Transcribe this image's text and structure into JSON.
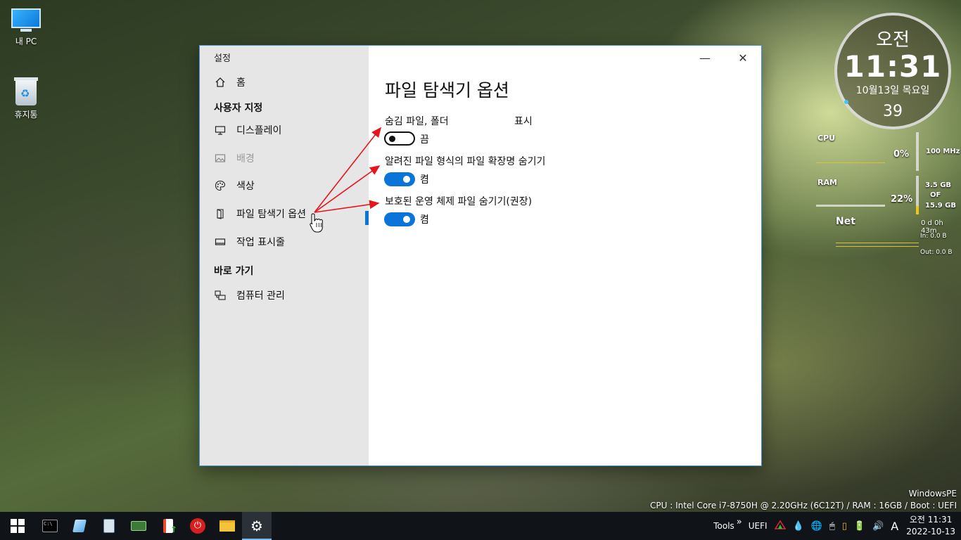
{
  "desktop": {
    "icons": [
      {
        "label": "내 PC"
      },
      {
        "label": "휴지통"
      }
    ]
  },
  "window": {
    "title": "설정",
    "minimize": "—",
    "close": "✕",
    "sidebar": {
      "home": "홈",
      "section_custom": "사용자 지정",
      "items": [
        {
          "label": "디스플레이",
          "icon": "monitor-icon"
        },
        {
          "label": "배경",
          "icon": "picture-icon"
        },
        {
          "label": "색상",
          "icon": "palette-icon"
        },
        {
          "label": "파일 탐색기 옵션",
          "icon": "door-icon"
        },
        {
          "label": "작업 표시줄",
          "icon": "taskbar-icon"
        }
      ],
      "section_shortcut": "바로 가기",
      "shortcut_items": [
        {
          "label": "컴퓨터 관리",
          "icon": "computer-management-icon"
        }
      ]
    },
    "main": {
      "title": "파일 탐색기 옵션",
      "options": [
        {
          "label": "숨김 파일, 폴더",
          "extra": "표시",
          "state": "끔",
          "on": false
        },
        {
          "label": "알려진 파일 형식의 파일 확장명 숨기기",
          "state": "켬",
          "on": true
        },
        {
          "label": "보호된 운영 체제 파일 숨기기(권장)",
          "state": "켬",
          "on": true
        }
      ]
    }
  },
  "clock_widget": {
    "ampm": "오전",
    "time": "11:31",
    "date": "10월13일 목요일",
    "seconds": "39"
  },
  "system_meter": {
    "cpu_label": "CPU",
    "cpu_value": "0%",
    "cpu_freq": "100 MHz",
    "ram_label": "RAM",
    "ram_value": "22%",
    "ram_used": "3.5 GB",
    "ram_of": "OF",
    "ram_total": "15.9 GB",
    "net_label": "Net",
    "uptime": "0 d 0h 43m",
    "net_in": "In: 0.0 B",
    "net_out": "Out: 0.0 B"
  },
  "pe_info": {
    "name": "WindowsPE",
    "specs": "CPU : Intel Core i7-8750H @ 2.20GHz (6C12T) / RAM : 16GB / Boot : UEFI"
  },
  "taskbar": {
    "apps": [
      "start",
      "cmd",
      "notepad",
      "calculator",
      "hardware",
      "installer",
      "power",
      "explorer",
      "settings"
    ],
    "tools_label": "Tools",
    "chevron": "»",
    "uefi_label": "UEFI",
    "ime": "A",
    "time": "오전 11:31",
    "date": "2022-10-13"
  },
  "colors": {
    "accent": "#0a74d8",
    "arrow": "#e8141c",
    "sidebar_bg": "#e6e6e6",
    "taskbar_bg": "#101418"
  }
}
